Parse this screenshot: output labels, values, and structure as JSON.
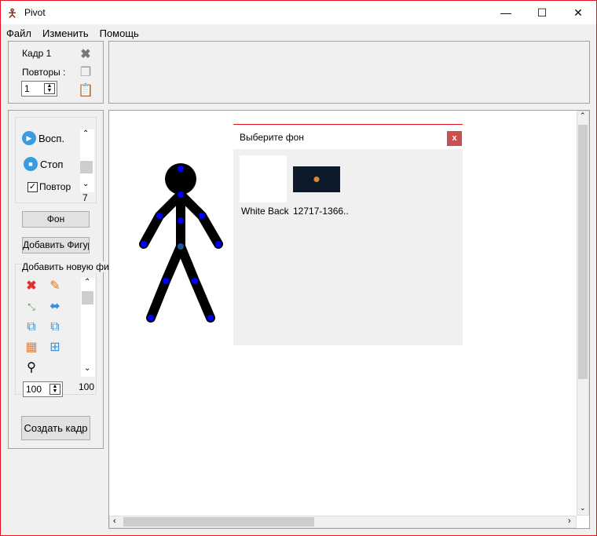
{
  "window": {
    "title": "Pivot",
    "minimize": "—",
    "maximize": "☐",
    "close": "✕"
  },
  "menu": [
    "Файл",
    "Изменить",
    "Помощь"
  ],
  "frame": {
    "label": "Кадр 1",
    "repeats_label": "Повторы :",
    "repeats_value": "1"
  },
  "playback": {
    "play": "Восп.",
    "stop": "Стоп",
    "loop": "Повтор",
    "loop_checked": true,
    "speed_value": "7"
  },
  "buttons": {
    "background": "Фон",
    "add_figure": "Добавить Фигуру",
    "create_frame": "Создать кадр"
  },
  "figure_group": {
    "label": "Добавить новую фигуру",
    "scale_value": "100",
    "scale_readout": "100"
  },
  "dialog": {
    "title": "Выберите фон",
    "close": "x",
    "items": [
      {
        "label": "White Back"
      },
      {
        "label": "12717-1366.."
      }
    ]
  },
  "colors": {
    "accent": "#e81123",
    "joint": "#0000ff",
    "dialog_close": "#c9504f"
  }
}
